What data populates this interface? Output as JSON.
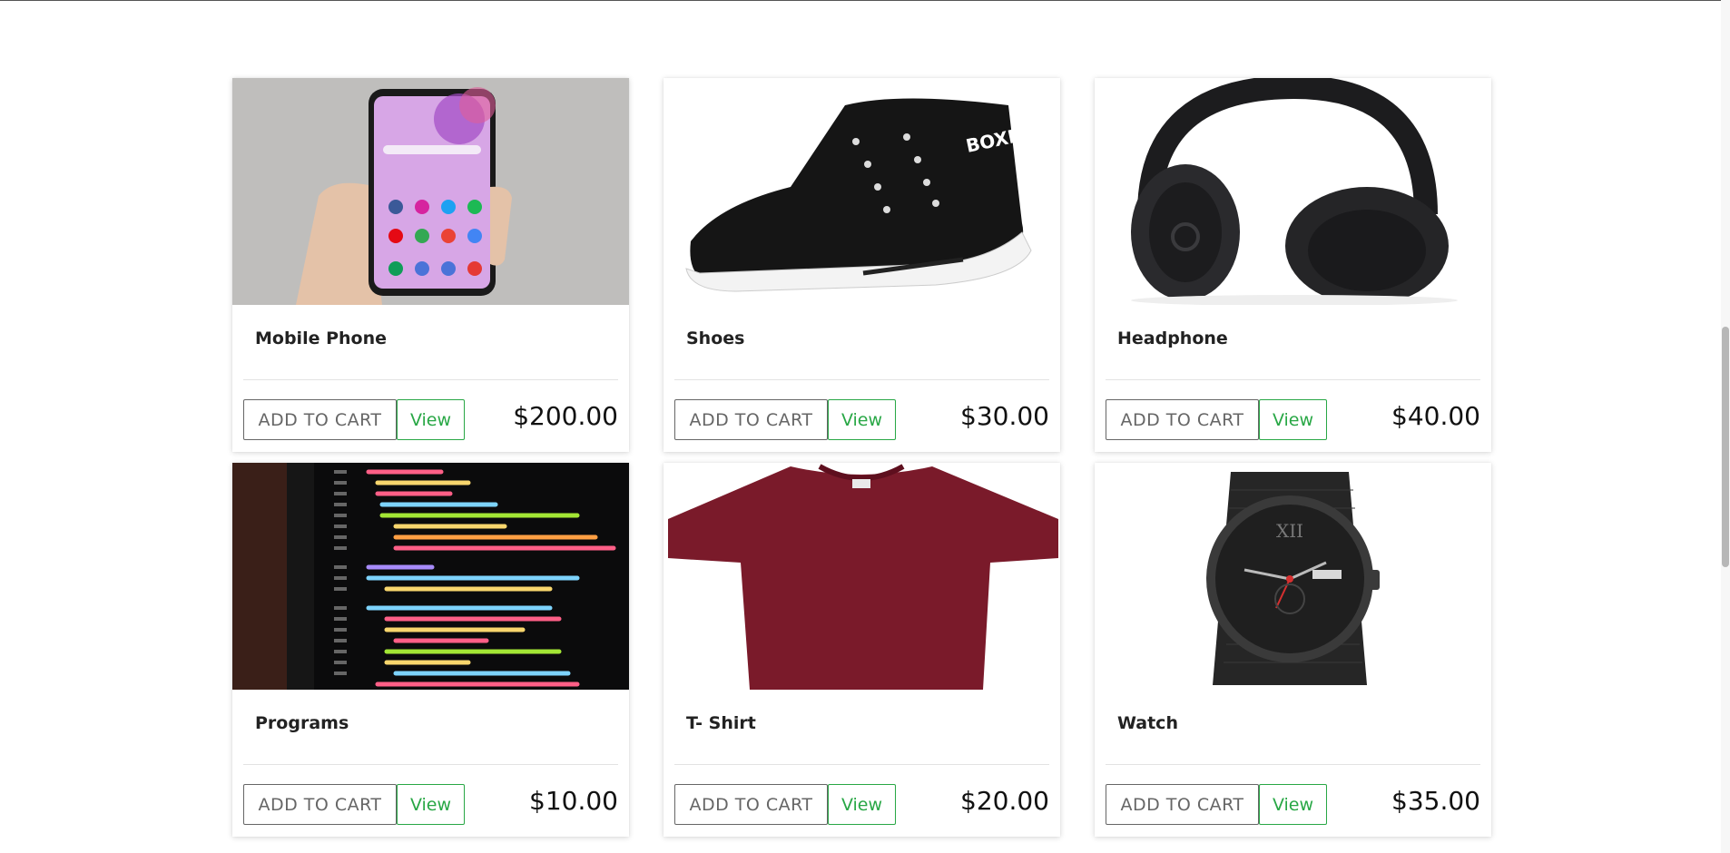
{
  "products": [
    {
      "id": "mobile-phone",
      "title": "Mobile Phone",
      "price": "$200.00",
      "add_to_cart_label": "ADD TO CART",
      "view_label": "View"
    },
    {
      "id": "shoes",
      "title": "Shoes",
      "price": "$30.00",
      "add_to_cart_label": "ADD TO CART",
      "view_label": "View",
      "image_text": "BOXER"
    },
    {
      "id": "headphone",
      "title": "Headphone",
      "price": "$40.00",
      "add_to_cart_label": "ADD TO CART",
      "view_label": "View"
    },
    {
      "id": "programs",
      "title": "Programs",
      "price": "$10.00",
      "add_to_cart_label": "ADD TO CART",
      "view_label": "View"
    },
    {
      "id": "t-shirt",
      "title": "T- Shirt",
      "price": "$20.00",
      "add_to_cart_label": "ADD TO CART",
      "view_label": "View"
    },
    {
      "id": "watch",
      "title": "Watch",
      "price": "$35.00",
      "add_to_cart_label": "ADD TO CART",
      "view_label": "View",
      "image_text": "XII"
    }
  ],
  "colors": {
    "view_button": "#28a745",
    "cart_button_border": "#666666",
    "tshirt": "#7a1a2a"
  }
}
